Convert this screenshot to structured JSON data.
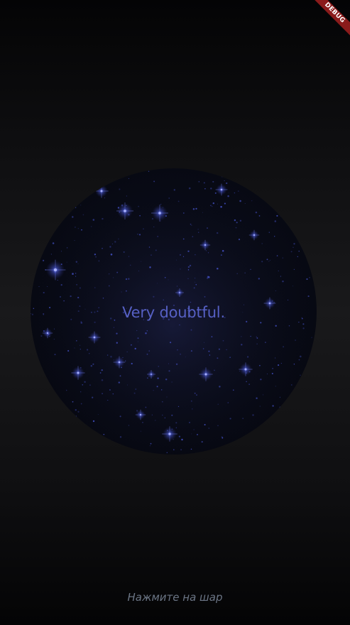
{
  "app": {
    "debug_label": "DEBUG"
  },
  "ball": {
    "answer": "Very doubtful.",
    "text_color": "#5660c4",
    "star_color": "#4a58d8"
  },
  "hint": {
    "text": "Нажмите на шар"
  }
}
